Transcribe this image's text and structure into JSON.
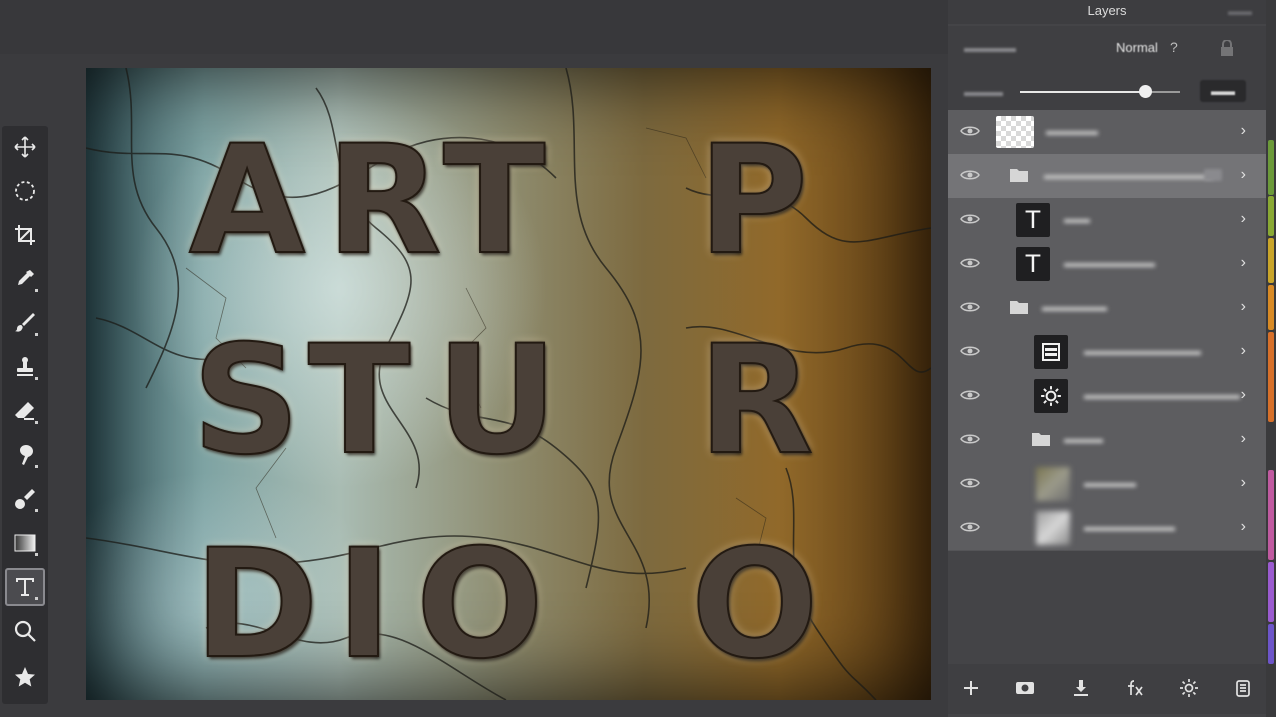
{
  "panel": {
    "title": "Layers",
    "blend_mode": "Normal",
    "blend_help": "?",
    "layers": [
      {
        "name": "",
        "type": "image",
        "thumb": "transparent-checker"
      },
      {
        "name": "",
        "type": "group",
        "selected": true
      },
      {
        "name": "",
        "type": "text",
        "thumb": "text-icon",
        "glyph": "T"
      },
      {
        "name": "",
        "type": "text",
        "thumb": "text-icon",
        "glyph": "T"
      },
      {
        "name": "",
        "type": "group"
      },
      {
        "name": "",
        "type": "adjustment",
        "thumb": "levels-icon"
      },
      {
        "name": "",
        "type": "adjustment",
        "thumb": "brightness-icon"
      },
      {
        "name": "",
        "type": "group"
      },
      {
        "name": "",
        "type": "image",
        "thumb": "photo-blurred"
      },
      {
        "name": "",
        "type": "image",
        "thumb": "photo-blurred"
      }
    ]
  },
  "canvas": {
    "letters": [
      "A",
      "R",
      "T",
      "P",
      "S",
      "T",
      "U",
      "R",
      "D",
      "I",
      "O",
      "O"
    ]
  },
  "toolbar": {
    "tools": [
      "move-icon",
      "marquee-icon",
      "crop-icon",
      "eyedropper-icon",
      "brush-icon",
      "stamp-icon",
      "eraser-icon",
      "smudge-icon",
      "heal-icon",
      "gradient-icon",
      "type-icon",
      "zoom-icon",
      "star-icon"
    ],
    "active": "type-icon"
  },
  "colors": {
    "accent_strip": [
      "#6c9a3a",
      "#8aa934",
      "#c9a52a",
      "#d88a25",
      "#d7702a",
      "#c05aa0",
      "#9b5bd0",
      "#6d55c9"
    ]
  }
}
